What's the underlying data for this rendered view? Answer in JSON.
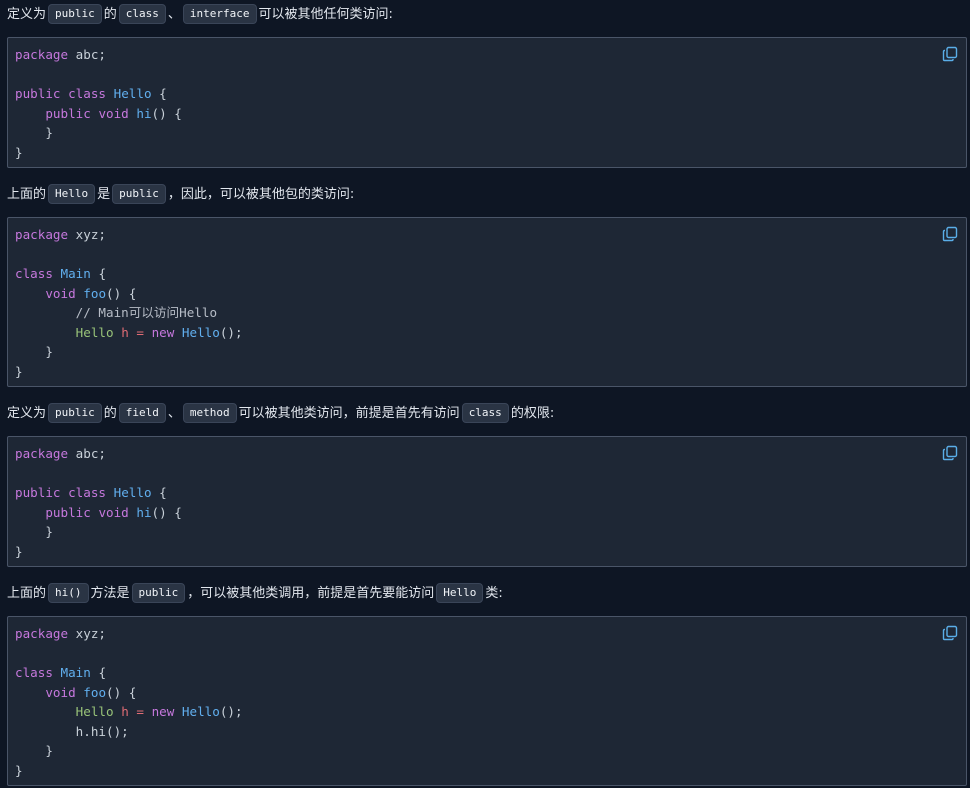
{
  "sections": [
    {
      "text_parts": [
        "定义为",
        "public",
        "的",
        "class",
        "、",
        "interface",
        "可以被其他任何类访问:"
      ],
      "code": [
        [
          [
            "kw",
            "package"
          ],
          [
            "pn",
            " abc;"
          ]
        ],
        [],
        [
          [
            "kw",
            "public"
          ],
          [
            "pn",
            " "
          ],
          [
            "kw",
            "class"
          ],
          [
            "pn",
            " "
          ],
          [
            "cls",
            "Hello"
          ],
          [
            "pn",
            " {"
          ]
        ],
        [
          [
            "pn",
            "    "
          ],
          [
            "kw",
            "public"
          ],
          [
            "pn",
            " "
          ],
          [
            "kw",
            "void"
          ],
          [
            "pn",
            " "
          ],
          [
            "cls",
            "hi"
          ],
          [
            "pn",
            "() {"
          ]
        ],
        [
          [
            "pn",
            "    }"
          ]
        ],
        [
          [
            "pn",
            "}"
          ]
        ]
      ]
    },
    {
      "text_parts": [
        "上面的",
        "Hello",
        "是",
        "public",
        "，因此，可以被其他包的类访问:"
      ],
      "code": [
        [
          [
            "kw",
            "package"
          ],
          [
            "pn",
            " xyz;"
          ]
        ],
        [],
        [
          [
            "kw",
            "class"
          ],
          [
            "pn",
            " "
          ],
          [
            "cls",
            "Main"
          ],
          [
            "pn",
            " {"
          ]
        ],
        [
          [
            "pn",
            "    "
          ],
          [
            "kw",
            "void"
          ],
          [
            "pn",
            " "
          ],
          [
            "cls",
            "foo"
          ],
          [
            "pn",
            "() {"
          ]
        ],
        [
          [
            "pn",
            "        "
          ],
          [
            "cm",
            "// Main可以访问Hello"
          ]
        ],
        [
          [
            "pn",
            "        "
          ],
          [
            "var",
            "Hello"
          ],
          [
            "pn",
            " "
          ],
          [
            "op",
            "h"
          ],
          [
            "pn",
            " "
          ],
          [
            "op",
            "="
          ],
          [
            "pn",
            " "
          ],
          [
            "kw",
            "new"
          ],
          [
            "pn",
            " "
          ],
          [
            "cls",
            "Hello"
          ],
          [
            "pn",
            "();"
          ]
        ],
        [
          [
            "pn",
            "    }"
          ]
        ],
        [
          [
            "pn",
            "}"
          ]
        ]
      ]
    },
    {
      "text_parts": [
        "定义为",
        "public",
        "的",
        "field",
        "、",
        "method",
        "可以被其他类访问，前提是首先有访问",
        "class",
        "的权限:"
      ],
      "code": [
        [
          [
            "kw",
            "package"
          ],
          [
            "pn",
            " abc;"
          ]
        ],
        [],
        [
          [
            "kw",
            "public"
          ],
          [
            "pn",
            " "
          ],
          [
            "kw",
            "class"
          ],
          [
            "pn",
            " "
          ],
          [
            "cls",
            "Hello"
          ],
          [
            "pn",
            " {"
          ]
        ],
        [
          [
            "pn",
            "    "
          ],
          [
            "kw",
            "public"
          ],
          [
            "pn",
            " "
          ],
          [
            "kw",
            "void"
          ],
          [
            "pn",
            " "
          ],
          [
            "cls",
            "hi"
          ],
          [
            "pn",
            "() {"
          ]
        ],
        [
          [
            "pn",
            "    }"
          ]
        ],
        [
          [
            "pn",
            "}"
          ]
        ]
      ]
    },
    {
      "text_parts": [
        "上面的",
        "hi()",
        "方法是",
        "public",
        "，可以被其他类调用，前提是首先要能访问",
        "Hello",
        "类:"
      ],
      "code": [
        [
          [
            "kw",
            "package"
          ],
          [
            "pn",
            " xyz;"
          ]
        ],
        [],
        [
          [
            "kw",
            "class"
          ],
          [
            "pn",
            " "
          ],
          [
            "cls",
            "Main"
          ],
          [
            "pn",
            " {"
          ]
        ],
        [
          [
            "pn",
            "    "
          ],
          [
            "kw",
            "void"
          ],
          [
            "pn",
            " "
          ],
          [
            "cls",
            "foo"
          ],
          [
            "pn",
            "() {"
          ]
        ],
        [
          [
            "pn",
            "        "
          ],
          [
            "var",
            "Hello"
          ],
          [
            "pn",
            " "
          ],
          [
            "op",
            "h"
          ],
          [
            "pn",
            " "
          ],
          [
            "op",
            "="
          ],
          [
            "pn",
            " "
          ],
          [
            "kw",
            "new"
          ],
          [
            "pn",
            " "
          ],
          [
            "cls",
            "Hello"
          ],
          [
            "pn",
            "();"
          ]
        ],
        [
          [
            "pn",
            "        h.hi();"
          ]
        ],
        [
          [
            "pn",
            "    }"
          ]
        ],
        [
          [
            "pn",
            "}"
          ]
        ]
      ]
    }
  ],
  "colors": {
    "keyword": "#c678dd",
    "class_name": "#61afef",
    "variable": "#98c379",
    "operator": "#e06c75"
  },
  "icons": {
    "copy": "copy-icon"
  }
}
